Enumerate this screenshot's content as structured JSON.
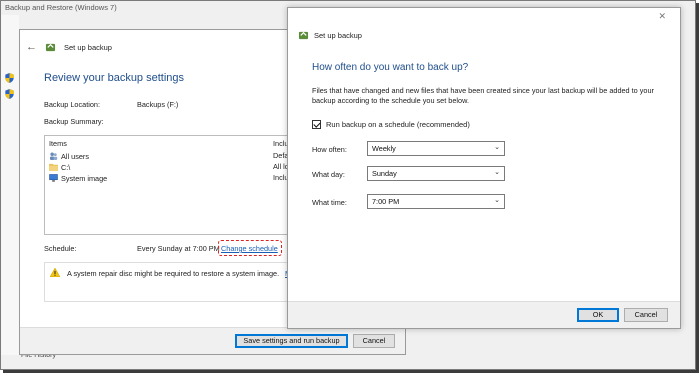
{
  "background_window": {
    "title": "Backup and Restore (Windows 7)",
    "bottom_text": "File History"
  },
  "wizard": {
    "header_label": "Set up backup",
    "heading": "Review your backup settings",
    "backup_location_label": "Backup Location:",
    "backup_location_value": "Backups (F:)",
    "backup_summary_label": "Backup Summary:",
    "items_header": "Items",
    "included_header": "Included in",
    "items": [
      {
        "name": "All users",
        "included": "Default Win",
        "icon": "users-icon"
      },
      {
        "name": "C:\\",
        "included": "All local dat",
        "icon": "folder-icon"
      },
      {
        "name": "System image",
        "included": "Included",
        "icon": "monitor-icon"
      }
    ],
    "schedule_label": "Schedule:",
    "schedule_value": "Every Sunday at 7:00 PM",
    "change_schedule": "Change schedule",
    "warning": "A system repair disc might be required to restore a system image.",
    "warning_link": "M",
    "save_button": "Save settings and run backup",
    "cancel_button": "Cancel"
  },
  "dialog": {
    "header_label": "Set up backup",
    "heading": "How often do you want to back up?",
    "description": "Files that have changed and new files that have been created since your last backup will be added to your backup according to the schedule you set below.",
    "checkbox_label": "Run backup on a schedule (recommended)",
    "checkbox_checked": true,
    "how_often_label": "How often:",
    "how_often_value": "Weekly",
    "what_day_label": "What day:",
    "what_day_value": "Sunday",
    "what_time_label": "What time:",
    "what_time_value": "7:00 PM",
    "ok_button": "OK",
    "cancel_button": "Cancel",
    "close_glyph": "✕"
  },
  "colors": {
    "heading_blue": "#1f4e8c",
    "link_blue": "#1a5fb4",
    "highlight_red": "#dd2222"
  }
}
